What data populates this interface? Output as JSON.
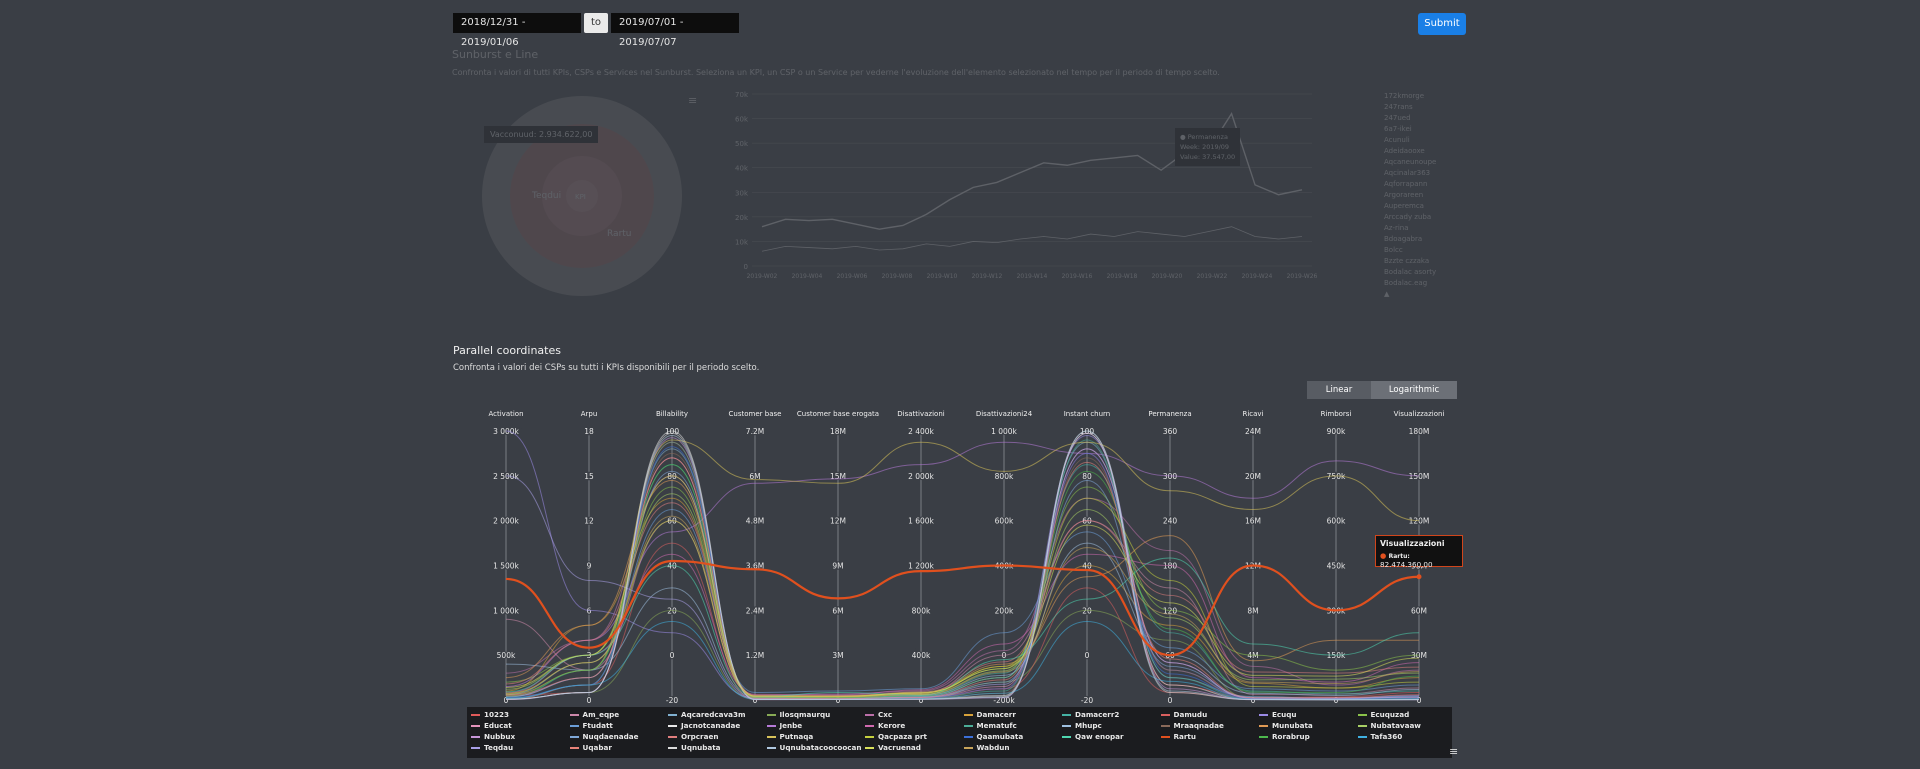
{
  "filters": {
    "date_from": "2018/12/31 - 2019/01/06",
    "to_label": "to",
    "date_to": "2019/07/01 - 2019/07/07",
    "submit_label": "Submit"
  },
  "sunburst_section": {
    "title": "Sunburst e Line",
    "description": "Confronta i valori di tutti KPIs, CSPs e Services nel Sunburst. Seleziona un KPI, un CSP o un Service per vederne l'evoluzione dell'elemento selezionato nel tempo per il periodo di tempo scelto.",
    "sunburst_tooltip": "Vacconuud: 2.934.622,00",
    "sunburst_labels": [
      "Teqdui",
      "Rartu",
      "KPI"
    ],
    "line_tooltip": [
      "● Permanenza",
      "Week: 2019/09",
      "Value: 37.547,00"
    ],
    "line_y_ticks": [
      "70k",
      "60k",
      "50k",
      "40k",
      "30k",
      "20k",
      "10k",
      "0"
    ],
    "line_x_ticks": [
      "2019-W02",
      "2019-W04",
      "2019-W06",
      "2019-W08",
      "2019-W10",
      "2019-W12",
      "2019-W14",
      "2019-W16",
      "2019-W18",
      "2019-W20",
      "2019-W22",
      "2019-W24",
      "2019-W26"
    ],
    "line_series": {
      "main": [
        16000,
        19000,
        18500,
        19000,
        17000,
        15000,
        16500,
        21000,
        27000,
        32000,
        34000,
        38000,
        42000,
        41000,
        43000,
        44000,
        45000,
        39000,
        46000,
        47000,
        62000,
        33000,
        29000,
        31000
      ],
      "secondary": [
        6000,
        8000,
        7500,
        7000,
        8000,
        6500,
        7000,
        9000,
        8000,
        10000,
        9500,
        11000,
        12000,
        11000,
        13000,
        12000,
        14000,
        13000,
        12000,
        14000,
        16000,
        12000,
        11000,
        12000
      ]
    },
    "side_list": [
      "172kmorge",
      "247rans",
      "247ued",
      "6a7-ikei",
      "Acunuli",
      "Adeidaooxe",
      "Aqcaneunoupe",
      "Aqcinalar363",
      "Aqforrapann",
      "Argorareen",
      "Auperemca",
      "Arccady zuba",
      "Az-rina",
      "Bdoagabra",
      "Bolcc",
      "Bzzte czzaka",
      "Bodalac asorty",
      "Bodalac.eag",
      "▲"
    ]
  },
  "parallel_section": {
    "title": "Parallel coordinates",
    "description": "Confronta i valori dei CSPs su tutti i KPIs disponibili per il periodo scelto.",
    "scale_options": [
      "Linear",
      "Logarithmic"
    ],
    "selected_scale": "Logarithmic"
  },
  "chart_data": {
    "type": "parallel_coordinates",
    "axes": [
      {
        "name": "Activation",
        "ticks": [
          "3 000k",
          "2 500k",
          "2 000k",
          "1 500k",
          "1 000k",
          "500k",
          "0"
        ],
        "min": 0,
        "max": 3000000
      },
      {
        "name": "Arpu",
        "ticks": [
          "18",
          "15",
          "12",
          "9",
          "6",
          "3",
          "0"
        ],
        "min": 0,
        "max": 18
      },
      {
        "name": "Billability",
        "ticks": [
          "100",
          "80",
          "60",
          "40",
          "20",
          "0",
          "-20"
        ],
        "min": -20,
        "max": 100
      },
      {
        "name": "Customer base",
        "ticks": [
          "7.2M",
          "6M",
          "4.8M",
          "3.6M",
          "2.4M",
          "1.2M",
          "0"
        ],
        "min": 0,
        "max": 7200000
      },
      {
        "name": "Customer base erogata",
        "ticks": [
          "18M",
          "15M",
          "12M",
          "9M",
          "6M",
          "3M",
          "0"
        ],
        "min": 0,
        "max": 18000000
      },
      {
        "name": "Disattivazioni",
        "ticks": [
          "2 400k",
          "2 000k",
          "1 600k",
          "1 200k",
          "800k",
          "400k",
          "0"
        ],
        "min": 0,
        "max": 2400000
      },
      {
        "name": "Disattivazioni24",
        "ticks": [
          "1 000k",
          "800k",
          "600k",
          "400k",
          "200k",
          "0",
          "-200k"
        ],
        "min": -200000,
        "max": 1000000
      },
      {
        "name": "Instant churn",
        "ticks": [
          "100",
          "80",
          "60",
          "40",
          "20",
          "0",
          "-20"
        ],
        "min": -20,
        "max": 100
      },
      {
        "name": "Permanenza",
        "ticks": [
          "360",
          "300",
          "240",
          "180",
          "120",
          "60",
          "0"
        ],
        "min": 0,
        "max": 360
      },
      {
        "name": "Ricavi",
        "ticks": [
          "24M",
          "20M",
          "16M",
          "12M",
          "8M",
          "4M",
          "0"
        ],
        "min": 0,
        "max": 24000000
      },
      {
        "name": "Rimborsi",
        "ticks": [
          "900k",
          "750k",
          "600k",
          "450k",
          "300k",
          "150k",
          "0"
        ],
        "min": 0,
        "max": 900000
      },
      {
        "name": "Visualizzazioni",
        "ticks": [
          "180M",
          "150M",
          "120M",
          "90M",
          "60M",
          "30M",
          "0"
        ],
        "min": 0,
        "max": 180000000
      }
    ],
    "series": [
      {
        "name": "Rartu",
        "color": "#e0501e",
        "highlight": true,
        "values": [
          1350000,
          3.5,
          42,
          3500000,
          6800000,
          1150000,
          400000,
          38,
          60,
          12000000,
          300000,
          82474360
        ]
      },
      {
        "name": "10223",
        "color": "#e05a5a",
        "values": [
          50000,
          0.5,
          95,
          50000,
          100000,
          20000,
          -150000,
          90,
          20,
          200000,
          10000,
          5000000
        ]
      },
      {
        "name": "Am_eqpe",
        "color": "#cc88aa",
        "values": [
          900000,
          2,
          60,
          100000,
          300000,
          60000,
          0,
          60,
          150,
          500000,
          20000,
          8000000
        ]
      },
      {
        "name": "Aqcaredcava3m",
        "color": "#80b0d0",
        "values": [
          20000,
          1,
          92,
          40000,
          90000,
          30000,
          -100000,
          95,
          30,
          300000,
          5000,
          2000000
        ]
      },
      {
        "name": "Ilosqmaurqu",
        "color": "#88aa55",
        "values": [
          10000,
          0.5,
          20,
          20000,
          50000,
          10000,
          -120000,
          20,
          80,
          100000,
          3000,
          1000000
        ]
      },
      {
        "name": "Cxc",
        "color": "#bb6fa8",
        "values": [
          300000,
          4,
          80,
          120000,
          400000,
          80000,
          20000,
          70,
          200,
          3000000,
          50000,
          20000000
        ]
      },
      {
        "name": "Damacerr",
        "color": "#d8a23a",
        "values": [
          100000,
          5,
          70,
          80000,
          200000,
          50000,
          -50000,
          40,
          100,
          1500000,
          40000,
          15000000
        ]
      },
      {
        "name": "Damacerr2",
        "color": "#45b2a4",
        "values": [
          30000,
          2,
          85,
          60000,
          150000,
          40000,
          -80000,
          85,
          90,
          800000,
          20000,
          6000000
        ]
      },
      {
        "name": "Damudu",
        "color": "#d95f5f",
        "values": [
          5000,
          1,
          50,
          10000,
          40000,
          8000,
          -150000,
          30,
          10,
          100000,
          2000,
          500000
        ]
      },
      {
        "name": "Ecuqu",
        "color": "#9b8be6",
        "values": [
          3000000,
          6,
          10,
          50000,
          100000,
          30000,
          -100000,
          98,
          40,
          200000,
          5000,
          3000000
        ]
      },
      {
        "name": "Ecuquzad",
        "color": "#8bc24a",
        "values": [
          200000,
          3,
          75,
          90000,
          180000,
          70000,
          -60000,
          75,
          120,
          4000000,
          100000,
          30000000
        ]
      },
      {
        "name": "Educat",
        "color": "#e494bc",
        "values": [
          40000,
          1.5,
          88,
          30000,
          70000,
          20000,
          -140000,
          92,
          50,
          150000,
          8000,
          1500000
        ]
      },
      {
        "name": "Ftudatt",
        "color": "#6b9ed8",
        "values": [
          60000,
          2.5,
          65,
          200000,
          600000,
          100000,
          100000,
          55,
          70,
          1000000,
          30000,
          10000000
        ]
      },
      {
        "name": "Jacnotcanadae",
        "color": "#e8e8e8",
        "values": [
          10000,
          0.5,
          100,
          20000,
          50000,
          10000,
          -180000,
          100,
          20,
          50000,
          1000,
          300000
        ]
      },
      {
        "name": "Jenbe",
        "color": "#b67ad8",
        "values": [
          150000,
          4,
          55,
          5800000,
          14800000,
          2100000,
          950000,
          90,
          300,
          18000000,
          800000,
          150000000
        ]
      },
      {
        "name": "Kerore",
        "color": "#d06ab0",
        "values": [
          80000,
          3,
          45,
          150000,
          350000,
          90000,
          50000,
          45,
          180,
          2000000,
          60000,
          25000000
        ]
      },
      {
        "name": "Mematufc",
        "color": "#4cae98",
        "values": [
          20000,
          1,
          95,
          25000,
          60000,
          15000,
          -160000,
          96,
          30,
          100000,
          3000,
          800000
        ]
      },
      {
        "name": "Mhupc",
        "color": "#9ec0e0",
        "values": [
          400000,
          2,
          30,
          70000,
          120000,
          40000,
          -90000,
          50,
          60,
          600000,
          15000,
          7000000
        ]
      },
      {
        "name": "Mraaqnadae",
        "color": "#8a6a5a",
        "values": [
          15000,
          1,
          90,
          20000,
          50000,
          12000,
          -170000,
          88,
          40,
          80000,
          2000,
          400000
        ]
      },
      {
        "name": "Munubata",
        "color": "#e09a55",
        "values": [
          250000,
          5,
          78,
          100000,
          250000,
          60000,
          -40000,
          35,
          220,
          3500000,
          200000,
          40000000
        ]
      },
      {
        "name": "Nubatavaaw",
        "color": "#a8cf65",
        "values": [
          120000,
          3,
          72,
          80000,
          220000,
          50000,
          -70000,
          65,
          110,
          1800000,
          70000,
          18000000
        ]
      },
      {
        "name": "Nubbux",
        "color": "#c796d8",
        "values": [
          5000,
          0.5,
          97,
          10000,
          30000,
          5000,
          -190000,
          99,
          15,
          30000,
          1000,
          200000
        ]
      },
      {
        "name": "Nuqdaenadae",
        "color": "#7fa8d8",
        "values": [
          35000,
          1.5,
          82,
          40000,
          90000,
          25000,
          -120000,
          78,
          45,
          250000,
          6000,
          2500000
        ]
      },
      {
        "name": "Orpcraen",
        "color": "#e07e7e",
        "values": [
          180000,
          4,
          68,
          130000,
          280000,
          70000,
          -30000,
          60,
          140,
          2500000,
          90000,
          22000000
        ]
      },
      {
        "name": "Putnaqa",
        "color": "#d8c25a",
        "values": [
          60000,
          2,
          96,
          5900000,
          14500000,
          2300000,
          820000,
          95,
          280,
          17000000,
          750000,
          120000000
        ]
      },
      {
        "name": "Qacpaza prt",
        "color": "#c5d03e",
        "values": [
          70000,
          2.5,
          60,
          110000,
          260000,
          60000,
          -50000,
          70,
          160,
          1200000,
          40000,
          12000000
        ]
      },
      {
        "name": "Qaamubata",
        "color": "#3b6fd8",
        "values": [
          25000,
          1,
          93,
          30000,
          70000,
          18000,
          -150000,
          90,
          35,
          120000,
          4000,
          1200000
        ]
      },
      {
        "name": "Qaw enopar",
        "color": "#4fd6b0",
        "values": [
          90000,
          3,
          40,
          90000,
          500000,
          45000,
          -20000,
          25,
          190,
          5000000,
          150000,
          45000000
        ]
      },
      {
        "name": "Rorabrup",
        "color": "#4db84d",
        "values": [
          45000,
          2,
          85,
          60000,
          140000,
          35000,
          -100000,
          82,
          95,
          700000,
          25000,
          16000000
        ]
      },
      {
        "name": "Tafa360",
        "color": "#3fb0e0",
        "values": [
          15000,
          1,
          15,
          20000,
          45000,
          10000,
          -170000,
          15,
          25,
          60000,
          1500,
          600000
        ]
      },
      {
        "name": "Teqdau",
        "color": "#a9a0e8",
        "values": [
          2500000,
          8,
          25,
          40000,
          80000,
          25000,
          -130000,
          92,
          50,
          150000,
          4000,
          2000000
        ]
      },
      {
        "name": "Uqabar",
        "color": "#e8837a",
        "values": [
          55000,
          1.5,
          88,
          45000,
          95000,
          22000,
          -110000,
          86,
          55,
          200000,
          7000,
          3500000
        ]
      },
      {
        "name": "Uqnubata",
        "color": "#dcdcdc",
        "values": [
          10000,
          0.5,
          99,
          15000,
          35000,
          8000,
          -185000,
          99,
          10,
          40000,
          800,
          250000
        ]
      },
      {
        "name": "Uqnubatacoocoocan",
        "color": "#b0c8e0",
        "values": [
          8000,
          0.5,
          98,
          12000,
          30000,
          7000,
          -188000,
          100,
          12,
          35000,
          700,
          220000
        ]
      },
      {
        "name": "Vacruenad",
        "color": "#d8e05a",
        "values": [
          140000,
          3,
          80,
          100000,
          230000,
          65000,
          -60000,
          58,
          130,
          2200000,
          80000,
          28000000
        ]
      },
      {
        "name": "Wabdun",
        "color": "#c8a45a",
        "values": [
          75000,
          2.5,
          62,
          85000,
          200000,
          48000,
          -75000,
          48,
          115,
          1600000,
          55000,
          19000000
        ]
      }
    ],
    "tooltip": {
      "title": "Visualizzazioni",
      "series": "Rartu:",
      "value": "82.474.360,00"
    },
    "legend_columns": 10
  }
}
